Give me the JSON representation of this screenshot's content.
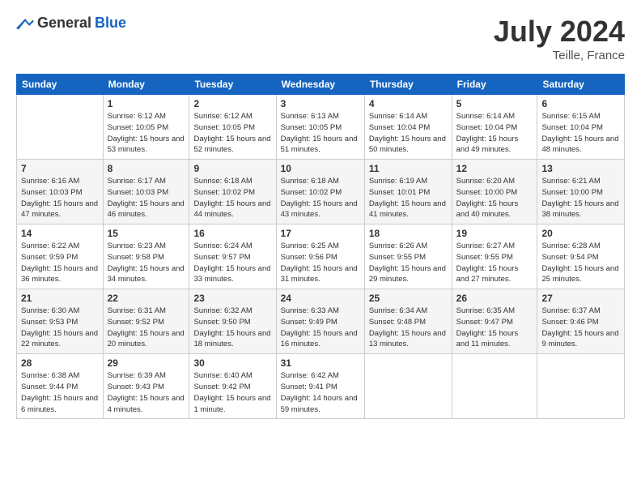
{
  "header": {
    "logo_general": "General",
    "logo_blue": "Blue",
    "month_year": "July 2024",
    "location": "Teille, France"
  },
  "weekdays": [
    "Sunday",
    "Monday",
    "Tuesday",
    "Wednesday",
    "Thursday",
    "Friday",
    "Saturday"
  ],
  "weeks": [
    [
      {
        "day": "",
        "sunrise": "",
        "sunset": "",
        "daylight": ""
      },
      {
        "day": "1",
        "sunrise": "Sunrise: 6:12 AM",
        "sunset": "Sunset: 10:05 PM",
        "daylight": "Daylight: 15 hours and 53 minutes."
      },
      {
        "day": "2",
        "sunrise": "Sunrise: 6:12 AM",
        "sunset": "Sunset: 10:05 PM",
        "daylight": "Daylight: 15 hours and 52 minutes."
      },
      {
        "day": "3",
        "sunrise": "Sunrise: 6:13 AM",
        "sunset": "Sunset: 10:05 PM",
        "daylight": "Daylight: 15 hours and 51 minutes."
      },
      {
        "day": "4",
        "sunrise": "Sunrise: 6:14 AM",
        "sunset": "Sunset: 10:04 PM",
        "daylight": "Daylight: 15 hours and 50 minutes."
      },
      {
        "day": "5",
        "sunrise": "Sunrise: 6:14 AM",
        "sunset": "Sunset: 10:04 PM",
        "daylight": "Daylight: 15 hours and 49 minutes."
      },
      {
        "day": "6",
        "sunrise": "Sunrise: 6:15 AM",
        "sunset": "Sunset: 10:04 PM",
        "daylight": "Daylight: 15 hours and 48 minutes."
      }
    ],
    [
      {
        "day": "7",
        "sunrise": "Sunrise: 6:16 AM",
        "sunset": "Sunset: 10:03 PM",
        "daylight": "Daylight: 15 hours and 47 minutes."
      },
      {
        "day": "8",
        "sunrise": "Sunrise: 6:17 AM",
        "sunset": "Sunset: 10:03 PM",
        "daylight": "Daylight: 15 hours and 46 minutes."
      },
      {
        "day": "9",
        "sunrise": "Sunrise: 6:18 AM",
        "sunset": "Sunset: 10:02 PM",
        "daylight": "Daylight: 15 hours and 44 minutes."
      },
      {
        "day": "10",
        "sunrise": "Sunrise: 6:18 AM",
        "sunset": "Sunset: 10:02 PM",
        "daylight": "Daylight: 15 hours and 43 minutes."
      },
      {
        "day": "11",
        "sunrise": "Sunrise: 6:19 AM",
        "sunset": "Sunset: 10:01 PM",
        "daylight": "Daylight: 15 hours and 41 minutes."
      },
      {
        "day": "12",
        "sunrise": "Sunrise: 6:20 AM",
        "sunset": "Sunset: 10:00 PM",
        "daylight": "Daylight: 15 hours and 40 minutes."
      },
      {
        "day": "13",
        "sunrise": "Sunrise: 6:21 AM",
        "sunset": "Sunset: 10:00 PM",
        "daylight": "Daylight: 15 hours and 38 minutes."
      }
    ],
    [
      {
        "day": "14",
        "sunrise": "Sunrise: 6:22 AM",
        "sunset": "Sunset: 9:59 PM",
        "daylight": "Daylight: 15 hours and 36 minutes."
      },
      {
        "day": "15",
        "sunrise": "Sunrise: 6:23 AM",
        "sunset": "Sunset: 9:58 PM",
        "daylight": "Daylight: 15 hours and 34 minutes."
      },
      {
        "day": "16",
        "sunrise": "Sunrise: 6:24 AM",
        "sunset": "Sunset: 9:57 PM",
        "daylight": "Daylight: 15 hours and 33 minutes."
      },
      {
        "day": "17",
        "sunrise": "Sunrise: 6:25 AM",
        "sunset": "Sunset: 9:56 PM",
        "daylight": "Daylight: 15 hours and 31 minutes."
      },
      {
        "day": "18",
        "sunrise": "Sunrise: 6:26 AM",
        "sunset": "Sunset: 9:55 PM",
        "daylight": "Daylight: 15 hours and 29 minutes."
      },
      {
        "day": "19",
        "sunrise": "Sunrise: 6:27 AM",
        "sunset": "Sunset: 9:55 PM",
        "daylight": "Daylight: 15 hours and 27 minutes."
      },
      {
        "day": "20",
        "sunrise": "Sunrise: 6:28 AM",
        "sunset": "Sunset: 9:54 PM",
        "daylight": "Daylight: 15 hours and 25 minutes."
      }
    ],
    [
      {
        "day": "21",
        "sunrise": "Sunrise: 6:30 AM",
        "sunset": "Sunset: 9:53 PM",
        "daylight": "Daylight: 15 hours and 22 minutes."
      },
      {
        "day": "22",
        "sunrise": "Sunrise: 6:31 AM",
        "sunset": "Sunset: 9:52 PM",
        "daylight": "Daylight: 15 hours and 20 minutes."
      },
      {
        "day": "23",
        "sunrise": "Sunrise: 6:32 AM",
        "sunset": "Sunset: 9:50 PM",
        "daylight": "Daylight: 15 hours and 18 minutes."
      },
      {
        "day": "24",
        "sunrise": "Sunrise: 6:33 AM",
        "sunset": "Sunset: 9:49 PM",
        "daylight": "Daylight: 15 hours and 16 minutes."
      },
      {
        "day": "25",
        "sunrise": "Sunrise: 6:34 AM",
        "sunset": "Sunset: 9:48 PM",
        "daylight": "Daylight: 15 hours and 13 minutes."
      },
      {
        "day": "26",
        "sunrise": "Sunrise: 6:35 AM",
        "sunset": "Sunset: 9:47 PM",
        "daylight": "Daylight: 15 hours and 11 minutes."
      },
      {
        "day": "27",
        "sunrise": "Sunrise: 6:37 AM",
        "sunset": "Sunset: 9:46 PM",
        "daylight": "Daylight: 15 hours and 9 minutes."
      }
    ],
    [
      {
        "day": "28",
        "sunrise": "Sunrise: 6:38 AM",
        "sunset": "Sunset: 9:44 PM",
        "daylight": "Daylight: 15 hours and 6 minutes."
      },
      {
        "day": "29",
        "sunrise": "Sunrise: 6:39 AM",
        "sunset": "Sunset: 9:43 PM",
        "daylight": "Daylight: 15 hours and 4 minutes."
      },
      {
        "day": "30",
        "sunrise": "Sunrise: 6:40 AM",
        "sunset": "Sunset: 9:42 PM",
        "daylight": "Daylight: 15 hours and 1 minute."
      },
      {
        "day": "31",
        "sunrise": "Sunrise: 6:42 AM",
        "sunset": "Sunset: 9:41 PM",
        "daylight": "Daylight: 14 hours and 59 minutes."
      },
      {
        "day": "",
        "sunrise": "",
        "sunset": "",
        "daylight": ""
      },
      {
        "day": "",
        "sunrise": "",
        "sunset": "",
        "daylight": ""
      },
      {
        "day": "",
        "sunrise": "",
        "sunset": "",
        "daylight": ""
      }
    ]
  ]
}
